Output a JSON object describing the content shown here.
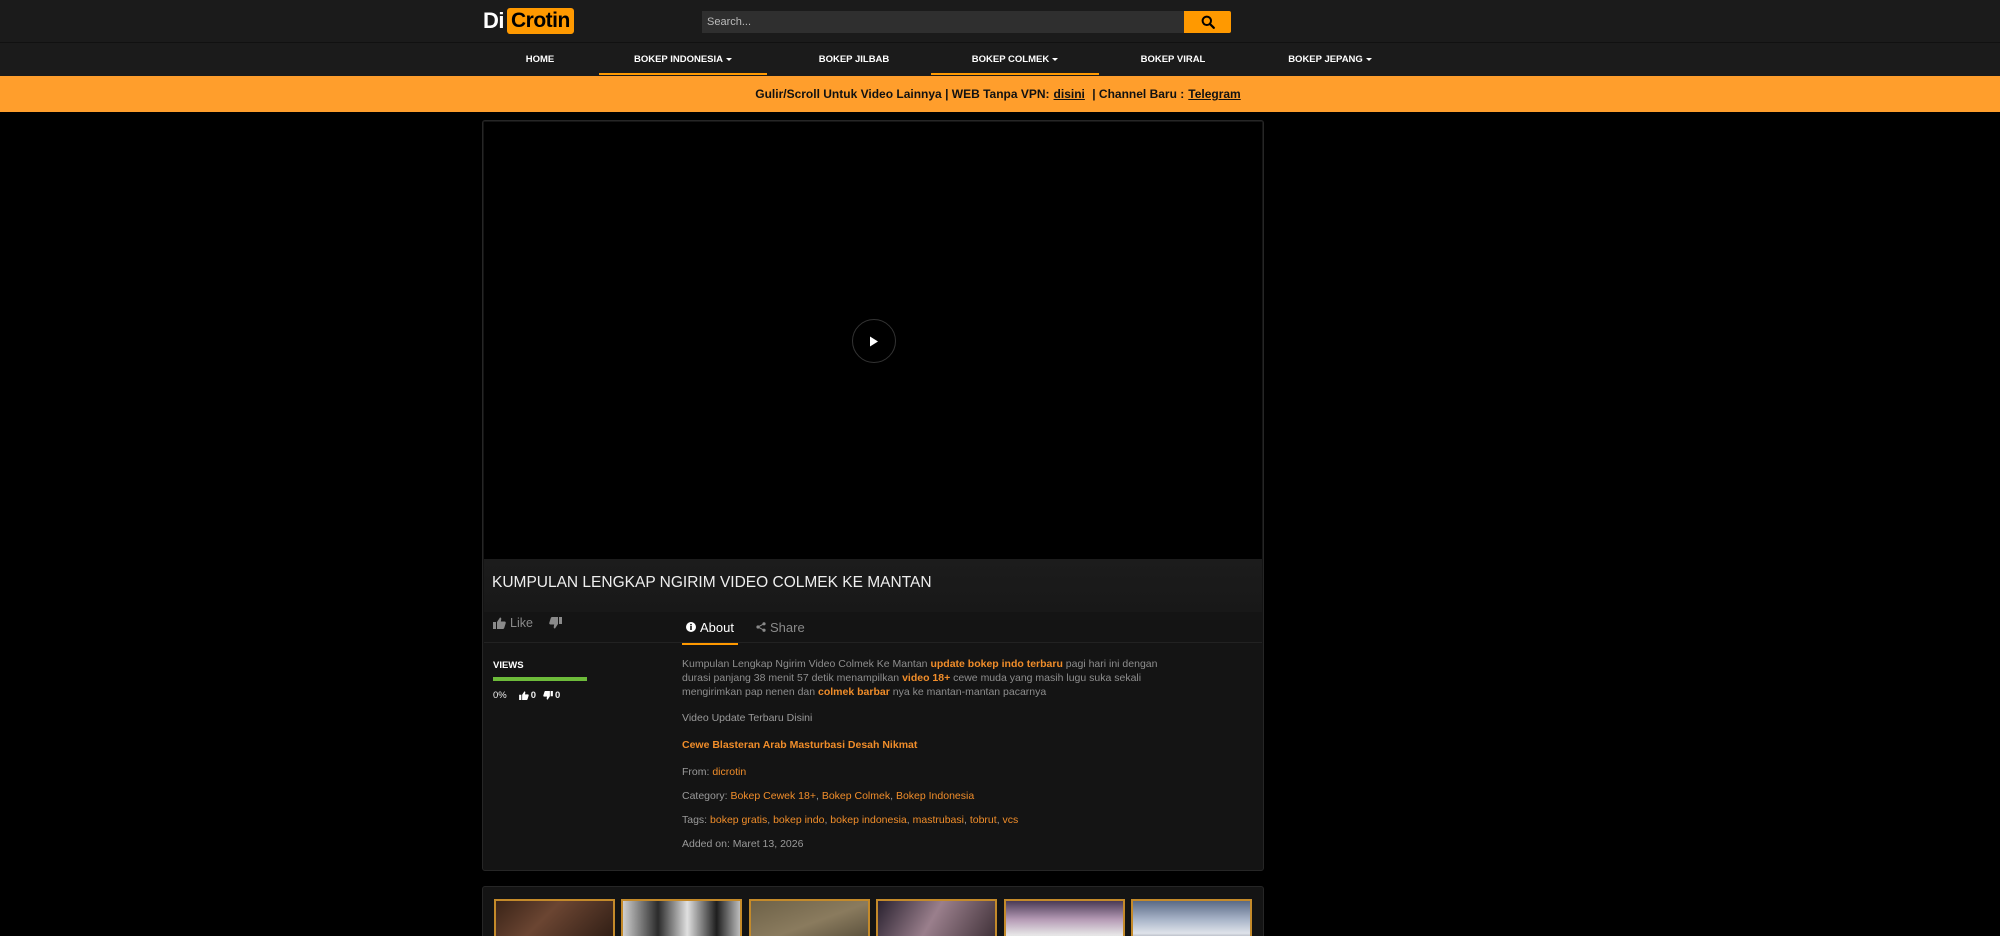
{
  "header": {
    "logo_left": "Di",
    "logo_right": "Crotin",
    "search_placeholder": "Search...",
    "search_icon": "search-icon"
  },
  "nav": {
    "items": [
      {
        "label": "HOME",
        "dropdown": false,
        "active": false
      },
      {
        "label": "BOKEP INDONESIA",
        "dropdown": true,
        "active": true
      },
      {
        "label": "BOKEP JILBAB",
        "dropdown": false,
        "active": false
      },
      {
        "label": "BOKEP COLMEK",
        "dropdown": true,
        "active": true
      },
      {
        "label": "BOKEP VIRAL",
        "dropdown": false,
        "active": false
      },
      {
        "label": "BOKEP JEPANG",
        "dropdown": true,
        "active": false
      }
    ]
  },
  "banner": {
    "text1": "Gulir/Scroll Untuk Video Lainnya | WEB Tanpa VPN:",
    "link1": "disini",
    "text2": " | Channel Baru :",
    "link2": "Telegram"
  },
  "video": {
    "title": "KUMPULAN LENGKAP NGIRIM VIDEO COLMEK KE MANTAN",
    "play_icon": "play-icon"
  },
  "actions": {
    "like_label": "Like",
    "like_icon": "thumbs-up-icon",
    "dislike_icon": "thumbs-down-icon"
  },
  "tabs": {
    "about": "About",
    "share": "Share"
  },
  "stats": {
    "views_label": "VIEWS",
    "percent": "0%",
    "likes": "0",
    "dislikes": "0"
  },
  "description": {
    "p1": "Kumpulan Lengkap Ngirim Video Colmek Ke Mantan ",
    "hl1": "update bokep indo terbaru",
    "p2": " pagi hari ini dengan durasi panjang 38 menit 57 detik menampilkan ",
    "hl2": "video 18+",
    "p3": " cewe muda yang masih lugu suka sekali mengirimkan pap nenen dan ",
    "hl3": "colmek barbar",
    "p4": " nya ke mantan-mantan pacarnya"
  },
  "meta": {
    "update_text": "Video Update Terbaru Disini",
    "featured_link": "Cewe Blasteran Arab Masturbasi Desah Nikmat",
    "from_label": "From: ",
    "from_value": "dicrotin",
    "category_label": "Category: ",
    "categories": [
      "Bokep Cewek 18+",
      "Bokep Colmek",
      "Bokep Indonesia"
    ],
    "tags_label": "Tags: ",
    "tags": [
      "bokep gratis",
      "bokep indo",
      "bokep indonesia",
      "mastrubasi",
      "tobrut",
      "vcs"
    ],
    "added_label": "Added on: ",
    "added_value": "Maret 13, 2026"
  },
  "thumbnails": {
    "count": 6
  },
  "colors": {
    "accent": "#ff9900",
    "banner": "#ff9e2c",
    "link": "#f08d2a",
    "views_bar": "#6dbb3a"
  }
}
